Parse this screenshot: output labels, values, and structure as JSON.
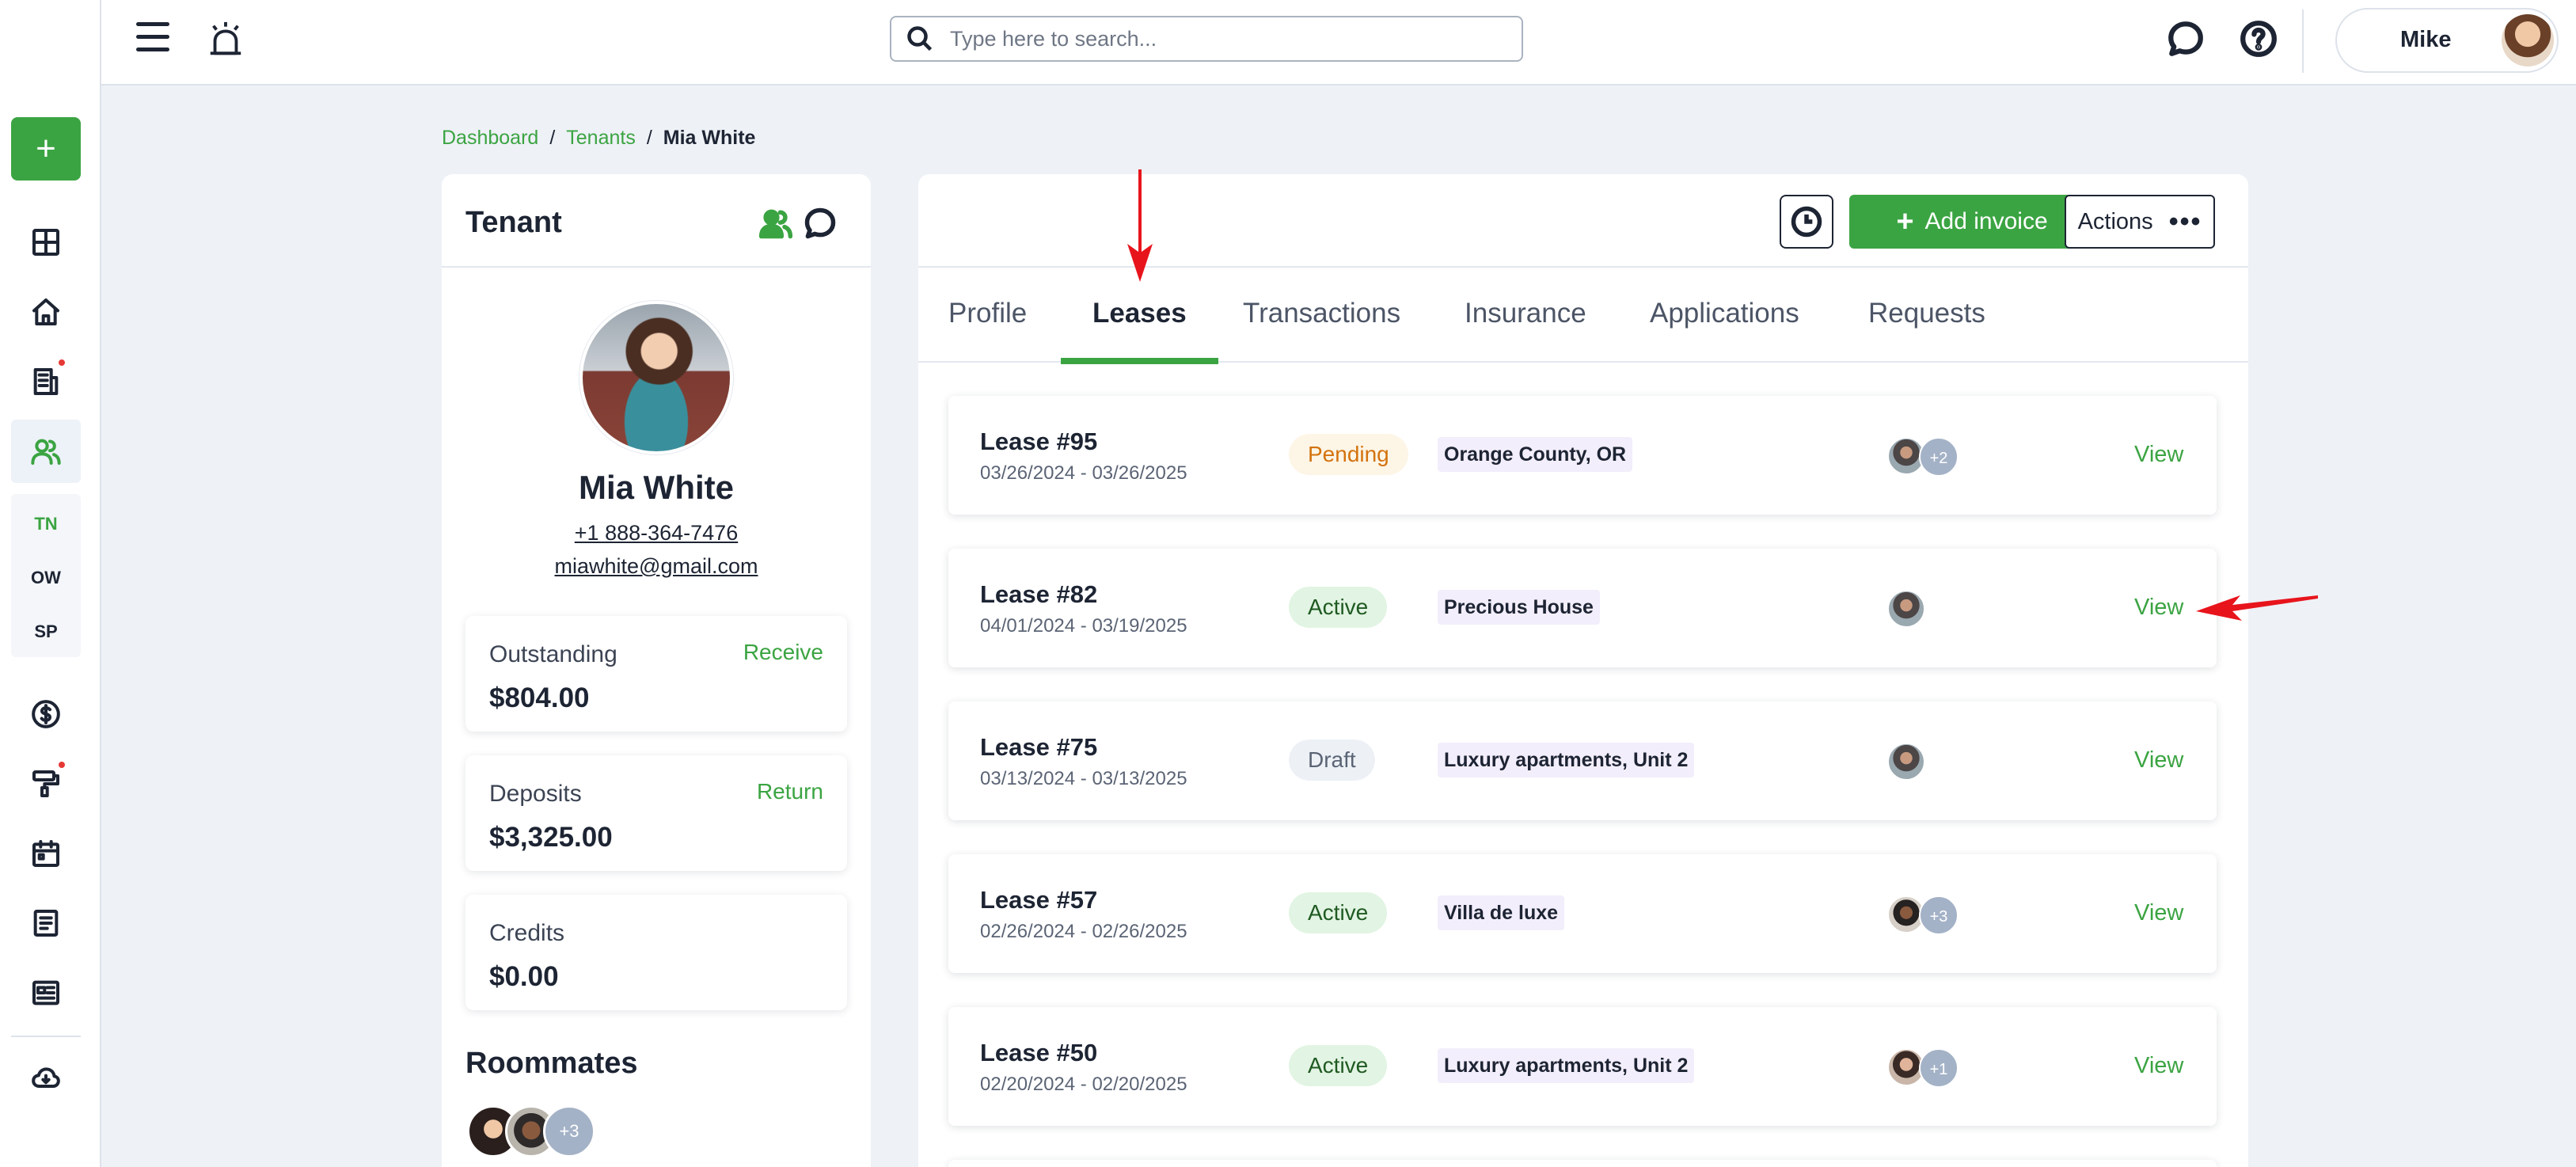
{
  "sidebar": {
    "add_label": "+",
    "sub_items": [
      "TN",
      "OW",
      "SP"
    ]
  },
  "header": {
    "search_placeholder": "Type here to search...",
    "user_name": "Mike"
  },
  "breadcrumb": {
    "items": [
      "Dashboard",
      "Tenants"
    ],
    "current": "Mia White",
    "separator": "/"
  },
  "tenant": {
    "card_title": "Tenant",
    "name": "Mia White",
    "phone": "+1 888-364-7476",
    "email": "miawhite@gmail.com",
    "outstanding": {
      "label": "Outstanding",
      "action": "Receive",
      "value": "$804.00"
    },
    "deposits": {
      "label": "Deposits",
      "action": "Return",
      "value": "$3,325.00"
    },
    "credits": {
      "label": "Credits",
      "value": "$0.00"
    },
    "roommates_title": "Roommates",
    "roommates_more": "+3"
  },
  "main": {
    "add_invoice_label": "Add invoice",
    "actions_label": "Actions",
    "tabs": [
      {
        "label": "Profile"
      },
      {
        "label": "Leases",
        "active": true
      },
      {
        "label": "Transactions"
      },
      {
        "label": "Insurance"
      },
      {
        "label": "Applications"
      },
      {
        "label": "Requests"
      }
    ],
    "leases": [
      {
        "title": "Lease #95",
        "dates": "03/26/2024 - 03/26/2025",
        "status": "Pending",
        "property": "Orange County, OR",
        "extra": "+2",
        "view": "View"
      },
      {
        "title": "Lease #82",
        "dates": "04/01/2024 - 03/19/2025",
        "status": "Active",
        "property": "Precious House",
        "extra": "",
        "view": "View"
      },
      {
        "title": "Lease #75",
        "dates": "03/13/2024 - 03/13/2025",
        "status": "Draft",
        "property": "Luxury apartments, Unit 2",
        "extra": "",
        "view": "View"
      },
      {
        "title": "Lease #57",
        "dates": "02/26/2024 - 02/26/2025",
        "status": "Active",
        "property": "Villa de luxe",
        "extra": "+3",
        "view": "View"
      },
      {
        "title": "Lease #50",
        "dates": "02/20/2024 - 02/20/2025",
        "status": "Active",
        "property": "Luxury apartments, Unit 2",
        "extra": "+1",
        "view": "View"
      }
    ]
  },
  "colors": {
    "accent": "#3ba442",
    "pending": "#d3730e",
    "annotation": "#e8141c"
  }
}
